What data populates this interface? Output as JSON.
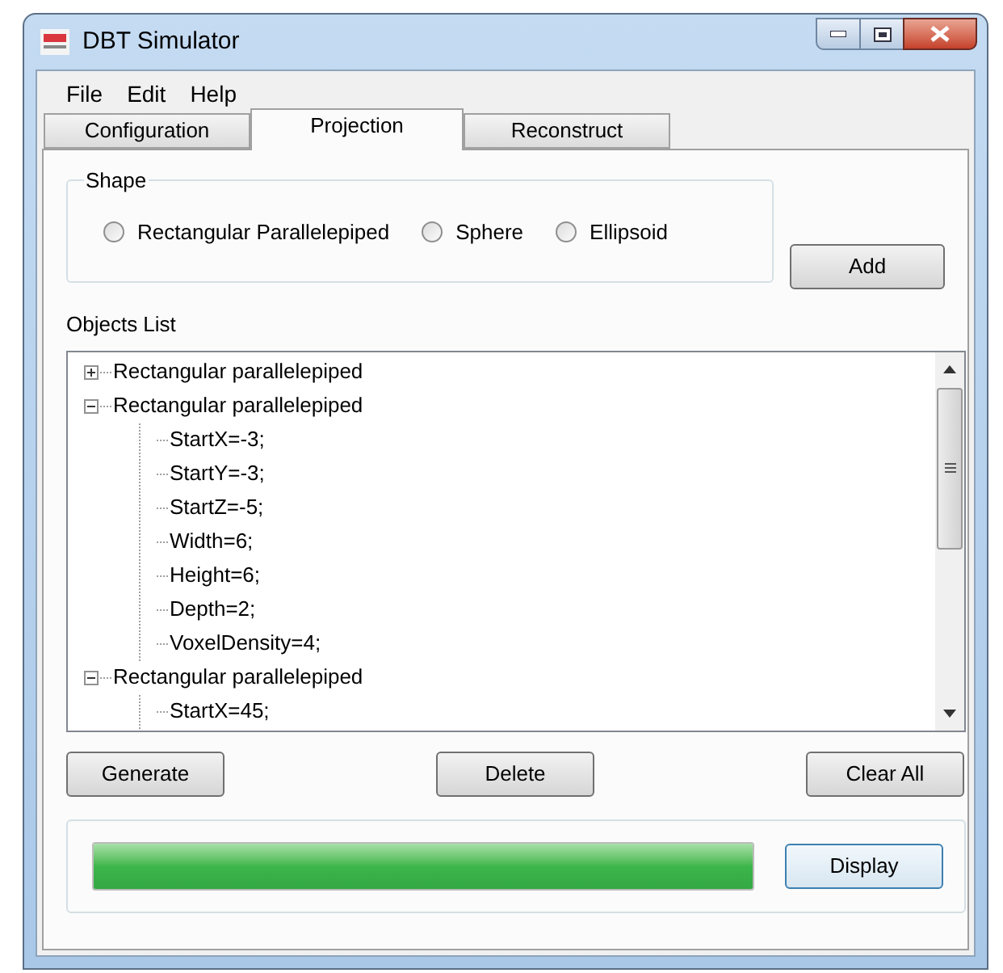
{
  "window": {
    "title": "DBT Simulator"
  },
  "menu": [
    "File",
    "Edit",
    "Help"
  ],
  "tabs": [
    {
      "label": "Configuration",
      "selected": false
    },
    {
      "label": "Projection",
      "selected": true
    },
    {
      "label": "Reconstruct",
      "selected": false
    }
  ],
  "shape_group": {
    "title": "Shape",
    "options": [
      {
        "label": "Rectangular Parallelepiped",
        "selected": false
      },
      {
        "label": "Sphere",
        "selected": false
      },
      {
        "label": "Ellipsoid",
        "selected": false
      }
    ]
  },
  "add_button": "Add",
  "objects_list": {
    "label": "Objects List",
    "items": [
      {
        "label": "Rectangular parallelepiped",
        "expanded": false
      },
      {
        "label": "Rectangular parallelepiped",
        "expanded": true,
        "children": [
          {
            "label": "StartX=-3;"
          },
          {
            "label": "StartY=-3;"
          },
          {
            "label": "StartZ=-5;"
          },
          {
            "label": "Width=6;"
          },
          {
            "label": "Height=6;"
          },
          {
            "label": "Depth=2;"
          },
          {
            "label": "VoxelDensity=4;"
          }
        ]
      },
      {
        "label": "Rectangular parallelepiped",
        "expanded": true,
        "children": [
          {
            "label": "StartX=45;"
          }
        ]
      }
    ]
  },
  "buttons": [
    "Generate",
    "Delete",
    "Clear All"
  ],
  "progress": {
    "level": 1
  },
  "display_button": "Display"
}
